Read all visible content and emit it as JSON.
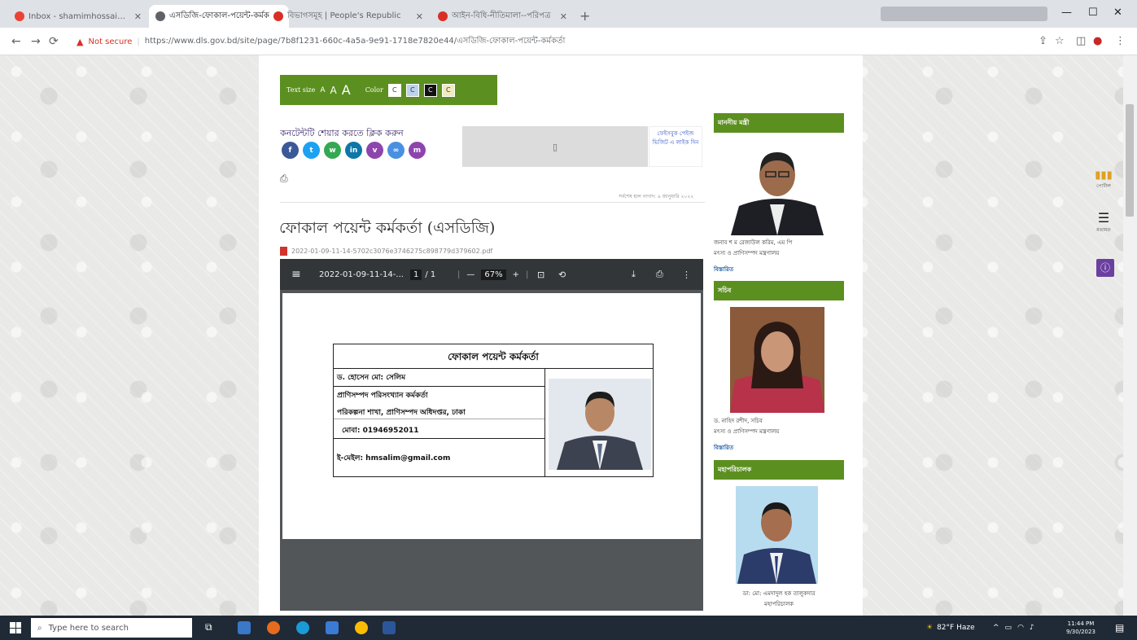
{
  "tabs": [
    {
      "title": "Inbox - shamimhossainima@gm",
      "favicon_color": "#ea4335"
    },
    {
      "title": "এসডিজি-ফোকাল-পয়েন্ট-কর্মক",
      "favicon_color": "#5f6368"
    },
    {
      "title": "বিভাগসমূহ | People's Republic",
      "favicon_color": "#d93025"
    },
    {
      "title": "আইন-বিধি-নীতিমালা--পরিপত্র",
      "favicon_color": "#d93025"
    }
  ],
  "address": {
    "security": "Not secure",
    "url": "https://www.dls.gov.bd/site/page/7b8f1231-660c-4a5a-9e91-1718e7820e44/এসডিজি-ফোকাল-পয়েন্ট-কর্মকর্তা"
  },
  "accessibility": {
    "text_size_label": "Text size",
    "size_small": "A",
    "size_mid": "A",
    "size_large": "A",
    "color_label": "Color",
    "color_btn": "C"
  },
  "share": {
    "label": "কনটেন্টটি শেয়ার করতে ক্লিক করুন",
    "fb_link": "ফেইসবুক পেইজ ভিজিট এ লাইক দিন"
  },
  "updated": "সর্বশেষ হাল নাগাদ: ৯ জানুয়ারি ২০২২",
  "page_title": "ফোকাল পয়েন্ট কর্মকর্তা (এসডিজি)",
  "pdf": {
    "filename": "2022-01-09-11-14-5702c3076e3746275c898779d379602.pdf",
    "viewer_name": "2022-01-09-11-14-...",
    "page_current": "1",
    "page_total": "/ 1",
    "zoom": "67%"
  },
  "card": {
    "title": "ফোকাল পয়েন্ট কর্মকর্তা",
    "name": "ড. হোসেন মো: সেলিম",
    "designation": "প্রাণিসম্পদ পরিসংখ্যান কর্মকর্তা",
    "office": "পরিকল্পনা শাখা, প্রাণিসম্পদ অধিদপ্তর, ঢাকা",
    "mobile": "মোবা: 01946952011",
    "email": "ই-মেইল: hmsalim@gmail.com"
  },
  "sidebar": {
    "minister": {
      "heading": "মাননীয় মন্ত্রী",
      "name": "জনাব শ ম রেজাউল করিম, এম পি",
      "ministry": "মৎস্য ও প্রাণিসম্পদ মন্ত্রণালয়",
      "link": "বিস্তারিত"
    },
    "secretary": {
      "heading": "সচিব",
      "name": "ড. নাহিদ রশীদ, সচিব",
      "ministry": "মৎস্য ও প্রাণিসম্পদ মন্ত্রণালয়",
      "link": "বিস্তারিত"
    },
    "dg": {
      "heading": "মহাপরিচালক",
      "name": "ডা: মো: এমদাদুল হক তালুকদার",
      "title": "মহাপরিচালক"
    }
  },
  "widgets": {
    "w1": "পোর্টাল",
    "w2": "মতামত"
  },
  "taskbar": {
    "search": "Type here to search",
    "weather": "82°F Haze",
    "time": "11:44 PM",
    "date": "9/30/2023"
  },
  "colors": {
    "green_bar": "#5b8f1f",
    "viewer_toolbar": "#323639"
  }
}
